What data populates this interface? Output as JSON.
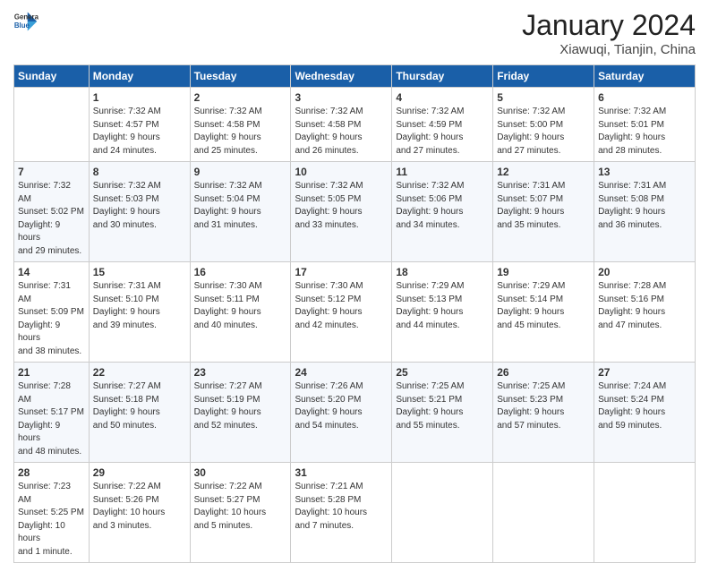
{
  "header": {
    "logo_line1": "General",
    "logo_line2": "Blue",
    "month_year": "January 2024",
    "location": "Xiawuqi, Tianjin, China"
  },
  "days_of_week": [
    "Sunday",
    "Monday",
    "Tuesday",
    "Wednesday",
    "Thursday",
    "Friday",
    "Saturday"
  ],
  "weeks": [
    [
      {
        "day": "",
        "info": ""
      },
      {
        "day": "1",
        "info": "Sunrise: 7:32 AM\nSunset: 4:57 PM\nDaylight: 9 hours\nand 24 minutes."
      },
      {
        "day": "2",
        "info": "Sunrise: 7:32 AM\nSunset: 4:58 PM\nDaylight: 9 hours\nand 25 minutes."
      },
      {
        "day": "3",
        "info": "Sunrise: 7:32 AM\nSunset: 4:58 PM\nDaylight: 9 hours\nand 26 minutes."
      },
      {
        "day": "4",
        "info": "Sunrise: 7:32 AM\nSunset: 4:59 PM\nDaylight: 9 hours\nand 27 minutes."
      },
      {
        "day": "5",
        "info": "Sunrise: 7:32 AM\nSunset: 5:00 PM\nDaylight: 9 hours\nand 27 minutes."
      },
      {
        "day": "6",
        "info": "Sunrise: 7:32 AM\nSunset: 5:01 PM\nDaylight: 9 hours\nand 28 minutes."
      }
    ],
    [
      {
        "day": "7",
        "info": "Sunrise: 7:32 AM\nSunset: 5:02 PM\nDaylight: 9 hours\nand 29 minutes."
      },
      {
        "day": "8",
        "info": "Sunrise: 7:32 AM\nSunset: 5:03 PM\nDaylight: 9 hours\nand 30 minutes."
      },
      {
        "day": "9",
        "info": "Sunrise: 7:32 AM\nSunset: 5:04 PM\nDaylight: 9 hours\nand 31 minutes."
      },
      {
        "day": "10",
        "info": "Sunrise: 7:32 AM\nSunset: 5:05 PM\nDaylight: 9 hours\nand 33 minutes."
      },
      {
        "day": "11",
        "info": "Sunrise: 7:32 AM\nSunset: 5:06 PM\nDaylight: 9 hours\nand 34 minutes."
      },
      {
        "day": "12",
        "info": "Sunrise: 7:31 AM\nSunset: 5:07 PM\nDaylight: 9 hours\nand 35 minutes."
      },
      {
        "day": "13",
        "info": "Sunrise: 7:31 AM\nSunset: 5:08 PM\nDaylight: 9 hours\nand 36 minutes."
      }
    ],
    [
      {
        "day": "14",
        "info": "Sunrise: 7:31 AM\nSunset: 5:09 PM\nDaylight: 9 hours\nand 38 minutes."
      },
      {
        "day": "15",
        "info": "Sunrise: 7:31 AM\nSunset: 5:10 PM\nDaylight: 9 hours\nand 39 minutes."
      },
      {
        "day": "16",
        "info": "Sunrise: 7:30 AM\nSunset: 5:11 PM\nDaylight: 9 hours\nand 40 minutes."
      },
      {
        "day": "17",
        "info": "Sunrise: 7:30 AM\nSunset: 5:12 PM\nDaylight: 9 hours\nand 42 minutes."
      },
      {
        "day": "18",
        "info": "Sunrise: 7:29 AM\nSunset: 5:13 PM\nDaylight: 9 hours\nand 44 minutes."
      },
      {
        "day": "19",
        "info": "Sunrise: 7:29 AM\nSunset: 5:14 PM\nDaylight: 9 hours\nand 45 minutes."
      },
      {
        "day": "20",
        "info": "Sunrise: 7:28 AM\nSunset: 5:16 PM\nDaylight: 9 hours\nand 47 minutes."
      }
    ],
    [
      {
        "day": "21",
        "info": "Sunrise: 7:28 AM\nSunset: 5:17 PM\nDaylight: 9 hours\nand 48 minutes."
      },
      {
        "day": "22",
        "info": "Sunrise: 7:27 AM\nSunset: 5:18 PM\nDaylight: 9 hours\nand 50 minutes."
      },
      {
        "day": "23",
        "info": "Sunrise: 7:27 AM\nSunset: 5:19 PM\nDaylight: 9 hours\nand 52 minutes."
      },
      {
        "day": "24",
        "info": "Sunrise: 7:26 AM\nSunset: 5:20 PM\nDaylight: 9 hours\nand 54 minutes."
      },
      {
        "day": "25",
        "info": "Sunrise: 7:25 AM\nSunset: 5:21 PM\nDaylight: 9 hours\nand 55 minutes."
      },
      {
        "day": "26",
        "info": "Sunrise: 7:25 AM\nSunset: 5:23 PM\nDaylight: 9 hours\nand 57 minutes."
      },
      {
        "day": "27",
        "info": "Sunrise: 7:24 AM\nSunset: 5:24 PM\nDaylight: 9 hours\nand 59 minutes."
      }
    ],
    [
      {
        "day": "28",
        "info": "Sunrise: 7:23 AM\nSunset: 5:25 PM\nDaylight: 10 hours\nand 1 minute."
      },
      {
        "day": "29",
        "info": "Sunrise: 7:22 AM\nSunset: 5:26 PM\nDaylight: 10 hours\nand 3 minutes."
      },
      {
        "day": "30",
        "info": "Sunrise: 7:22 AM\nSunset: 5:27 PM\nDaylight: 10 hours\nand 5 minutes."
      },
      {
        "day": "31",
        "info": "Sunrise: 7:21 AM\nSunset: 5:28 PM\nDaylight: 10 hours\nand 7 minutes."
      },
      {
        "day": "",
        "info": ""
      },
      {
        "day": "",
        "info": ""
      },
      {
        "day": "",
        "info": ""
      }
    ]
  ]
}
